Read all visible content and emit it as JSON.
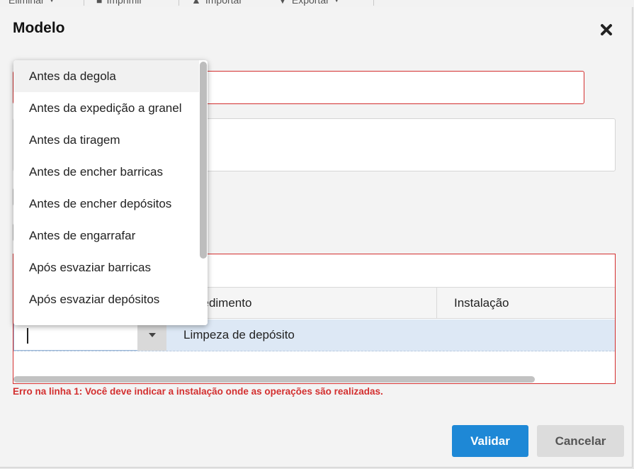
{
  "toolbar": {
    "items": [
      "Eliminar",
      "Imprimir",
      "Importar",
      "Exportar"
    ]
  },
  "modal": {
    "title": "Modelo",
    "close_icon": "close-icon"
  },
  "dropdown": {
    "options": [
      "Antes da degola",
      "Antes da expedição a granel",
      "Antes da tiragem",
      "Antes de encher barricas",
      "Antes de encher depósitos",
      "Antes de engarrafar",
      "Após esvaziar barricas",
      "Após esvaziar depósitos"
    ],
    "highlighted_index": 0
  },
  "grid": {
    "columns": {
      "procedimento": "cedimento",
      "instalacao": "Instalação"
    },
    "rows": [
      {
        "momento": "",
        "procedimento": "Limpeza de depósito",
        "instalacao": ""
      }
    ]
  },
  "error": "Erro na linha 1: Você deve indicar a instalação onde as operações são realizadas.",
  "buttons": {
    "validate": "Validar",
    "cancel": "Cancelar"
  },
  "colors": {
    "primary": "#1e88d6",
    "error": "#d32f2f",
    "row_selected": "#dde8f5"
  }
}
